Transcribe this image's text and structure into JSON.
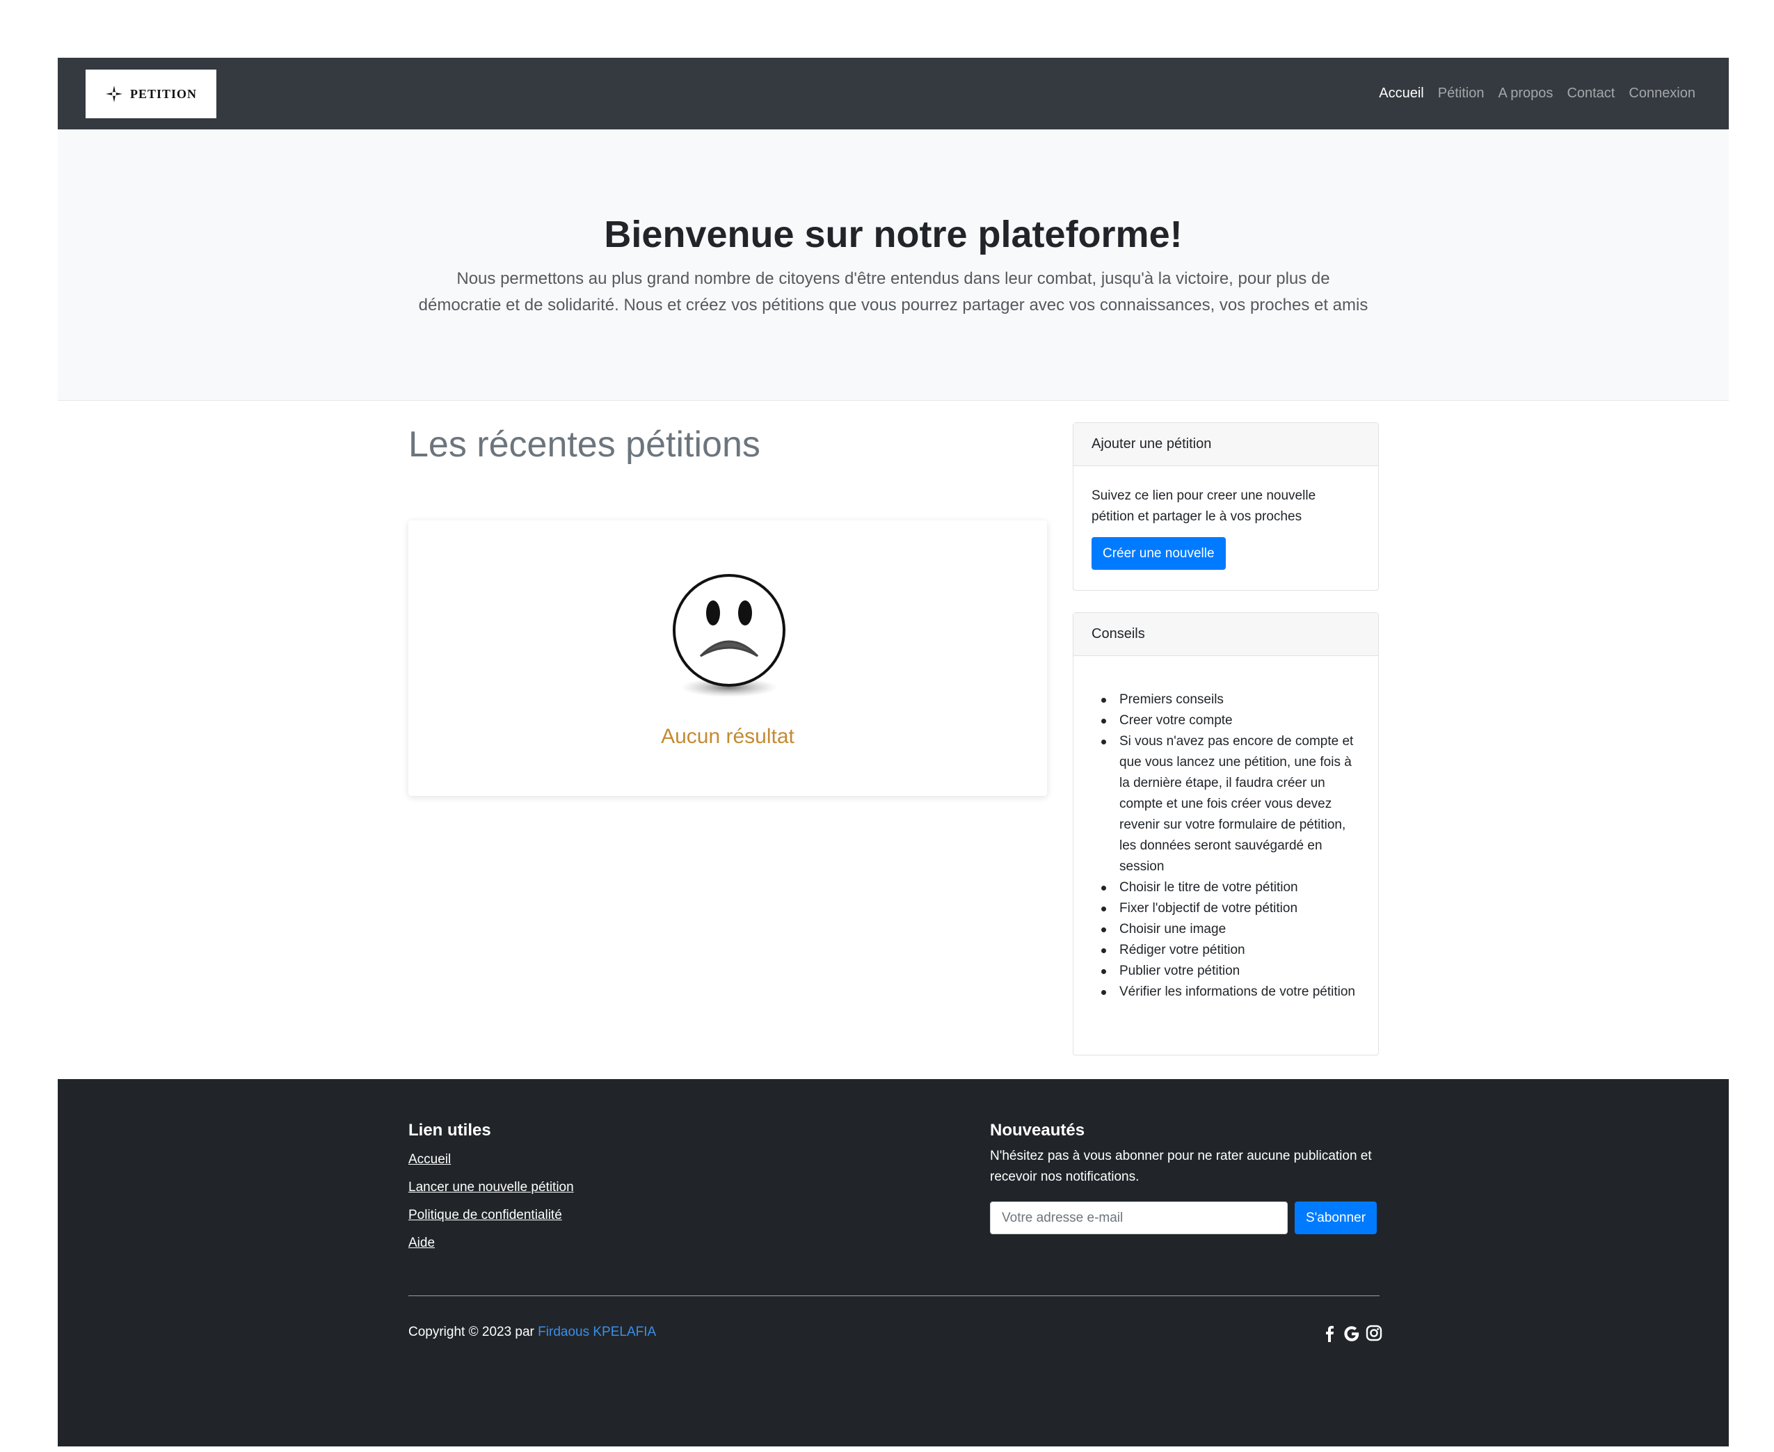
{
  "navbar": {
    "brand": "PETITION",
    "links": [
      "Accueil",
      "Pétition",
      "A propos",
      "Contact",
      "Connexion"
    ]
  },
  "hero": {
    "title": "Bienvenue sur notre plateforme!",
    "text": "Nous permettons au plus grand nombre de citoyens d'être entendus dans leur combat, jusqu'à la victoire, pour plus de démocratie et de solidarité. Nous et créez vos pétitions que vous pourrez partager avec vos connaissances, vos proches et amis"
  },
  "main": {
    "title": "Les récentes pétitions",
    "empty_text": "Aucun résultat"
  },
  "sidebar": {
    "add": {
      "header": "Ajouter une pétition",
      "text": "Suivez ce lien pour creer une nouvelle pétition et partager le à vos proches",
      "button": "Créer une nouvelle"
    },
    "tips": {
      "header": "Conseils",
      "items": [
        "Premiers conseils",
        "Creer votre compte",
        "Si vous n'avez pas encore de compte et que vous lancez une pétition, une fois à la dernière étape, il faudra créer un compte et une fois créer vous devez revenir sur votre formulaire de pétition, les données seront sauvégardé en session",
        "Choisir le titre de votre pétition",
        "Fixer l'objectif de votre pétition",
        "Choisir une image",
        "Rédiger votre pétition",
        "Publier votre pétition",
        "Vérifier les informations de votre pétition"
      ]
    }
  },
  "footer": {
    "links_heading": "Lien utiles",
    "links": [
      "Accueil",
      "Lancer une nouvelle pétition",
      "Politique de confidentialité",
      "Aide"
    ],
    "news_heading": "Nouveautés",
    "news_text": "N'hésitez pas à vous abonner pour ne rater aucune publication et recevoir nos notifications.",
    "email_placeholder": "Votre adresse e-mail",
    "subscribe_button": "S'abonner",
    "copyright_prefix": "Copyright © 2023 par ",
    "author": "Firdaous KPELAFIA",
    "social_icons": [
      "facebook-icon",
      "google-icon",
      "instagram-icon"
    ]
  },
  "colors": {
    "navbar_bg": "#343a40",
    "footer_bg": "#212529",
    "primary": "#007bff",
    "empty_text": "#c58a33",
    "hero_bg": "#f8f9fa"
  }
}
